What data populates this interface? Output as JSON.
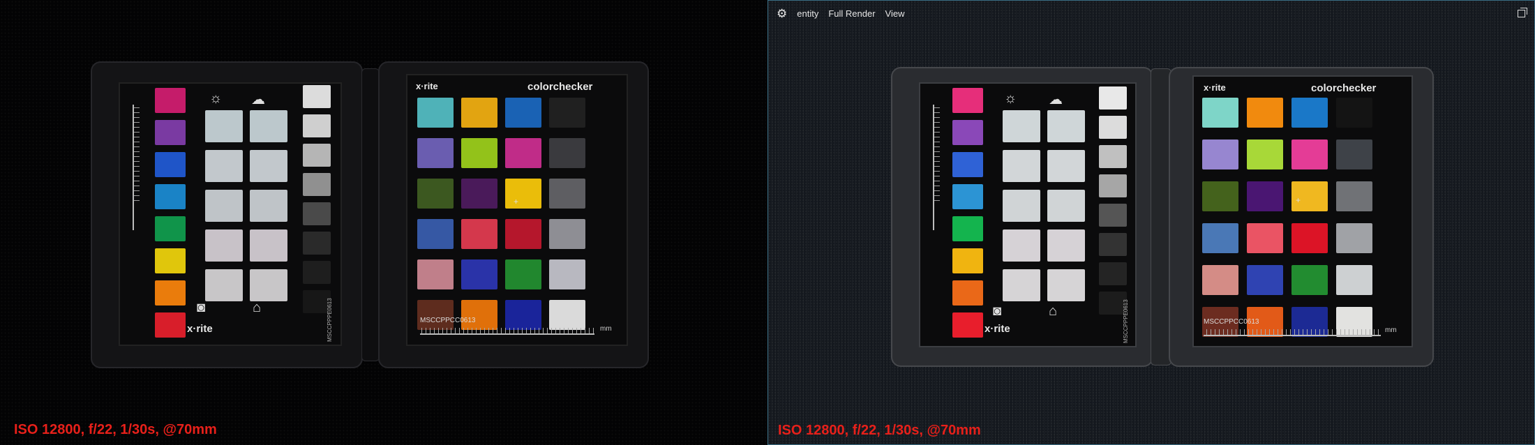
{
  "left_pane": {
    "caption": "ISO 12800, f/22, 1/30s, @70mm"
  },
  "right_pane": {
    "toolbar": {
      "settings_icon": "gear-icon",
      "item_entity": "entity",
      "item_full_render": "Full Render",
      "item_view": "View",
      "restore_icon": "restore-window-icon"
    },
    "caption": "ISO 12800, f/22, 1/30s, @70mm"
  },
  "chart": {
    "brand_small": "x·rite",
    "brand_logo": "colorchecker",
    "brand_bottom": "x·rite",
    "serial_front": "MSCCPPCC0613",
    "serial_back": "MSCCPPPE0613",
    "unit": "mm",
    "classic_colors_left": [
      "#4fb2b8",
      "#e2a411",
      "#1a62b4",
      "#202020",
      "#6a5db0",
      "#93c21a",
      "#c02c88",
      "#3a3a3e",
      "#3c5820",
      "#4a1a5a",
      "#eabd0a",
      "#5e5e62",
      "#3658a4",
      "#d4384c",
      "#b5172c",
      "#8e8e94",
      "#c07f8a",
      "#2a33a8",
      "#21872e",
      "#b8b8c0",
      "#5e2c1e",
      "#e0700a",
      "#1a249a",
      "#dadada"
    ],
    "classic_colors_right": [
      "#7ed5c8",
      "#f18a0e",
      "#1a78c8",
      "#141414",
      "#9786d0",
      "#a8d838",
      "#e43c96",
      "#3e4248",
      "#44621c",
      "#4a1672",
      "#f0b820",
      "#707276",
      "#4a78b6",
      "#ea5464",
      "#dc1426",
      "#a0a2a6",
      "#d48c86",
      "#2f43b2",
      "#228c30",
      "#cdd0d2",
      "#6c2c20",
      "#e25a18",
      "#1c2a94",
      "#e2e2e0"
    ],
    "side_colors_left": [
      "#c51c6a",
      "#7a3aa2",
      "#1f55c8",
      "#1a83c6",
      "#10944a",
      "#e0c60c",
      "#ea7c0c",
      "#d81e2a"
    ],
    "side_colors_right": [
      "#e62e7a",
      "#8a48b8",
      "#2f62d6",
      "#2c94d4",
      "#14b44e",
      "#f0b410",
      "#ea6818",
      "#e81e2c"
    ],
    "grey_left": [
      "#dcdcdc",
      "#cfcfcf",
      "#b5b5b5",
      "#909090",
      "#4a4a4a",
      "#2a2a2a",
      "#1e1e1e",
      "#171717"
    ],
    "grey_right": [
      "#e8e8e8",
      "#dcdcdc",
      "#c0c0c0",
      "#a6a6a6",
      "#555555",
      "#333333",
      "#242424",
      "#1c1c1c"
    ]
  }
}
